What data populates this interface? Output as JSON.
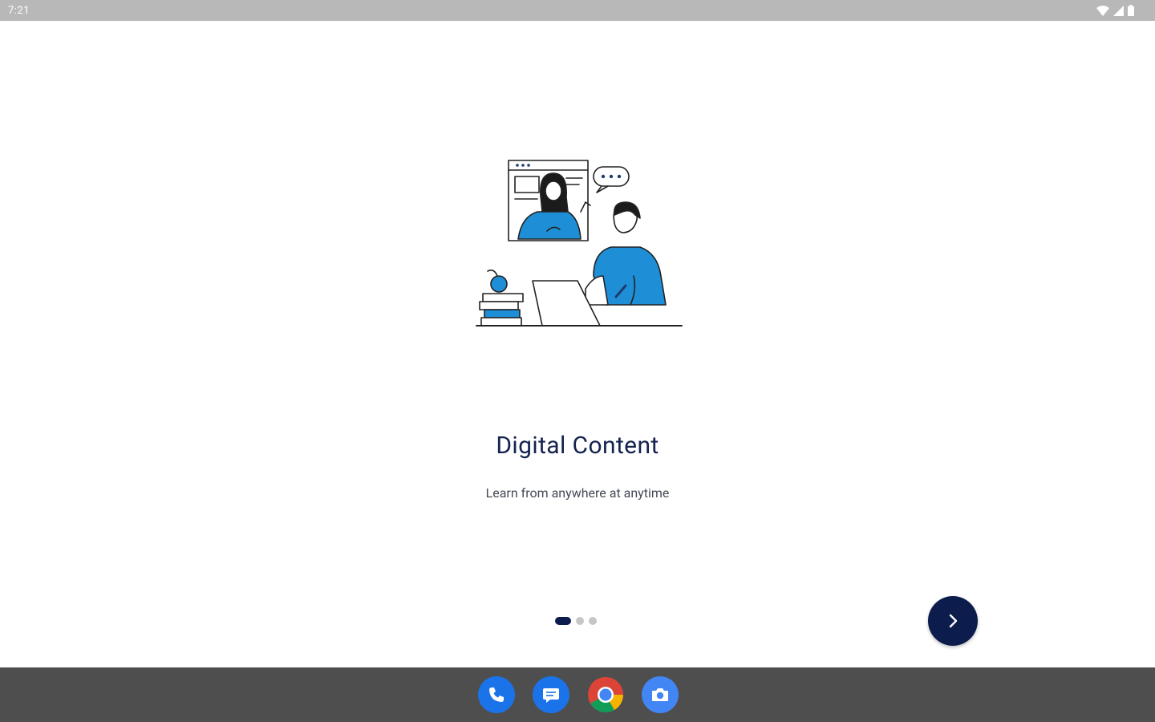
{
  "status_bar": {
    "time": "7:21",
    "icons": [
      "wifi-icon",
      "signal-icon",
      "battery-icon"
    ]
  },
  "onboarding": {
    "illustration": "online-learning-illustration",
    "title": "Digital Content",
    "subtitle": "Learn from anywhere at anytime",
    "page_indicator": {
      "total": 3,
      "current": 1
    },
    "next_button_icon": "chevron-right-icon"
  },
  "dock": {
    "apps": [
      {
        "name": "phone-app",
        "icon": "phone-icon"
      },
      {
        "name": "messages-app",
        "icon": "message-icon"
      },
      {
        "name": "chrome-app",
        "icon": "chrome-icon"
      },
      {
        "name": "camera-app",
        "icon": "camera-icon"
      }
    ]
  },
  "colors": {
    "accent": "#0c1c4d",
    "illustration_blue": "#1e8fd6",
    "status_bar": "#b8b8b8",
    "nav_bar": "#4e4e4e"
  }
}
